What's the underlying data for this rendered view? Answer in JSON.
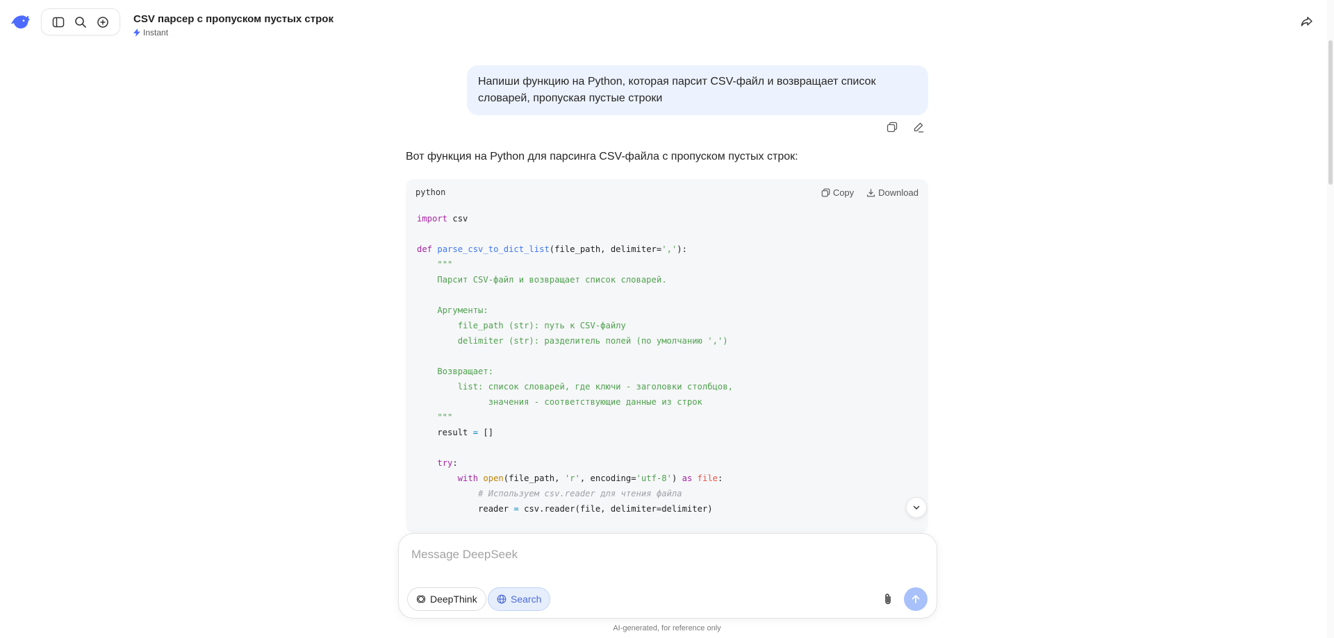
{
  "header": {
    "title": "CSV парсер с пропуском пустых строк",
    "mode": "Instant",
    "icons": {
      "logo": "deepseek-whale-logo",
      "sidebar": "sidebar-toggle-icon",
      "search": "search-icon",
      "new_chat": "new-chat-icon",
      "share": "share-icon"
    }
  },
  "conversation": {
    "user_message": "Напиши функцию на Python, которая парсит CSV-файл и возвращает список словарей, пропуская пустые строки",
    "assistant_intro": "Вот функция на Python для парсинга CSV-файла с пропуском пустых строк:",
    "code_block": {
      "language": "python",
      "copy_label": "Copy",
      "download_label": "Download"
    }
  },
  "composer": {
    "placeholder": "Message DeepSeek",
    "value": "",
    "deepthink_label": "DeepThink",
    "search_label": "Search"
  },
  "footer": {
    "disclaimer": "AI-generated, for reference only"
  },
  "colors": {
    "accent": "#4d6bfe",
    "user_bubble": "#edf3fe",
    "send_button": "#a8c1fa",
    "search_pill": "#e6eefc"
  }
}
